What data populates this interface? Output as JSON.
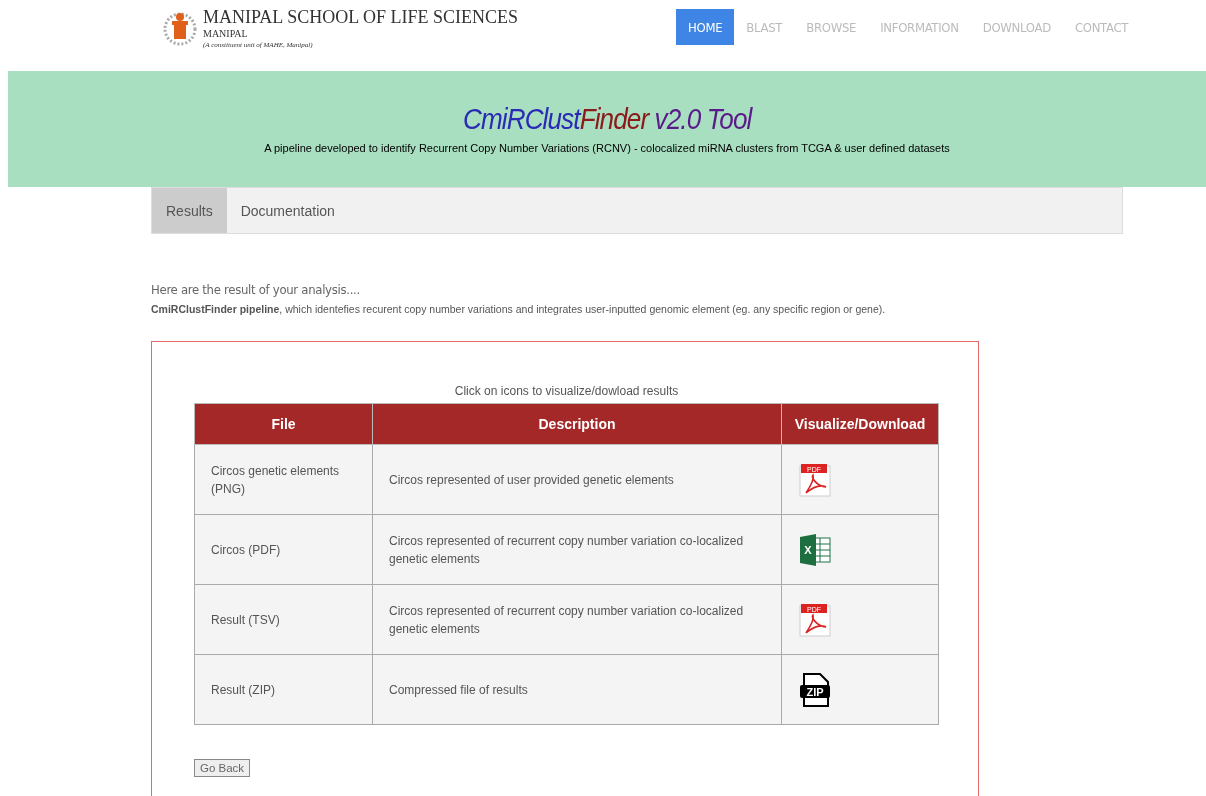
{
  "header": {
    "logo": {
      "title": "MANIPAL SCHOOL OF LIFE SCIENCES",
      "subtitle": "MANIPAL",
      "tagline": "(A constituent unit of MAHE, Manipal)"
    },
    "nav": [
      {
        "label": "HOME",
        "selected": true
      },
      {
        "label": "BLAST",
        "selected": false
      },
      {
        "label": "BROWSE",
        "selected": false
      },
      {
        "label": "INFORMATION",
        "selected": false
      },
      {
        "label": "DOWNLOAD",
        "selected": false
      },
      {
        "label": "CONTACT",
        "selected": false
      }
    ]
  },
  "banner": {
    "title_parts": [
      {
        "text": "CmiRClust",
        "color": "#2a2ab4"
      },
      {
        "text": "Finder",
        "color": "#8b1a1a"
      },
      {
        "text": " v2.0 Tool",
        "color": "#5a1a8a"
      }
    ],
    "subtitle": "A pipeline developed to identify Recurrent Copy Number Variations (RCNV) - colocalized miRNA clusters from TCGA & user defined datasets"
  },
  "tabs": [
    {
      "label": "Results",
      "selected": true
    },
    {
      "label": "Documentation",
      "selected": false
    }
  ],
  "intro": {
    "heading": "Here are the result of your analysis....",
    "text": "**CmiRClustFinder pipeline**, which identefies recurent copy number variations and integrates user-inputted genomic element (eg. any specific region or gene)."
  },
  "results": {
    "caption": "Click on icons to visualize/dowload results",
    "columns": [
      "File",
      "Description",
      "Visualize/Download"
    ],
    "rows": [
      {
        "file": "Circos genetic elements (PNG)",
        "description": "Circos represented of user provided genetic elements",
        "icon": {
          "kind": "pdf",
          "label": "PDF"
        }
      },
      {
        "file": "Circos (PDF)",
        "description": "Circos represented of recurrent copy number variation co-localized genetic elements",
        "icon": {
          "kind": "excel",
          "label": "X"
        }
      },
      {
        "file": "Result (TSV)",
        "description": "Circos represented of recurrent copy number variation co-localized genetic elements",
        "icon": {
          "kind": "pdf",
          "label": "PDF"
        }
      },
      {
        "file": "Result (ZIP)",
        "description": "Compressed file of results",
        "icon": {
          "kind": "zip",
          "label": "ZIP"
        }
      }
    ],
    "back_button": "Go Back"
  }
}
